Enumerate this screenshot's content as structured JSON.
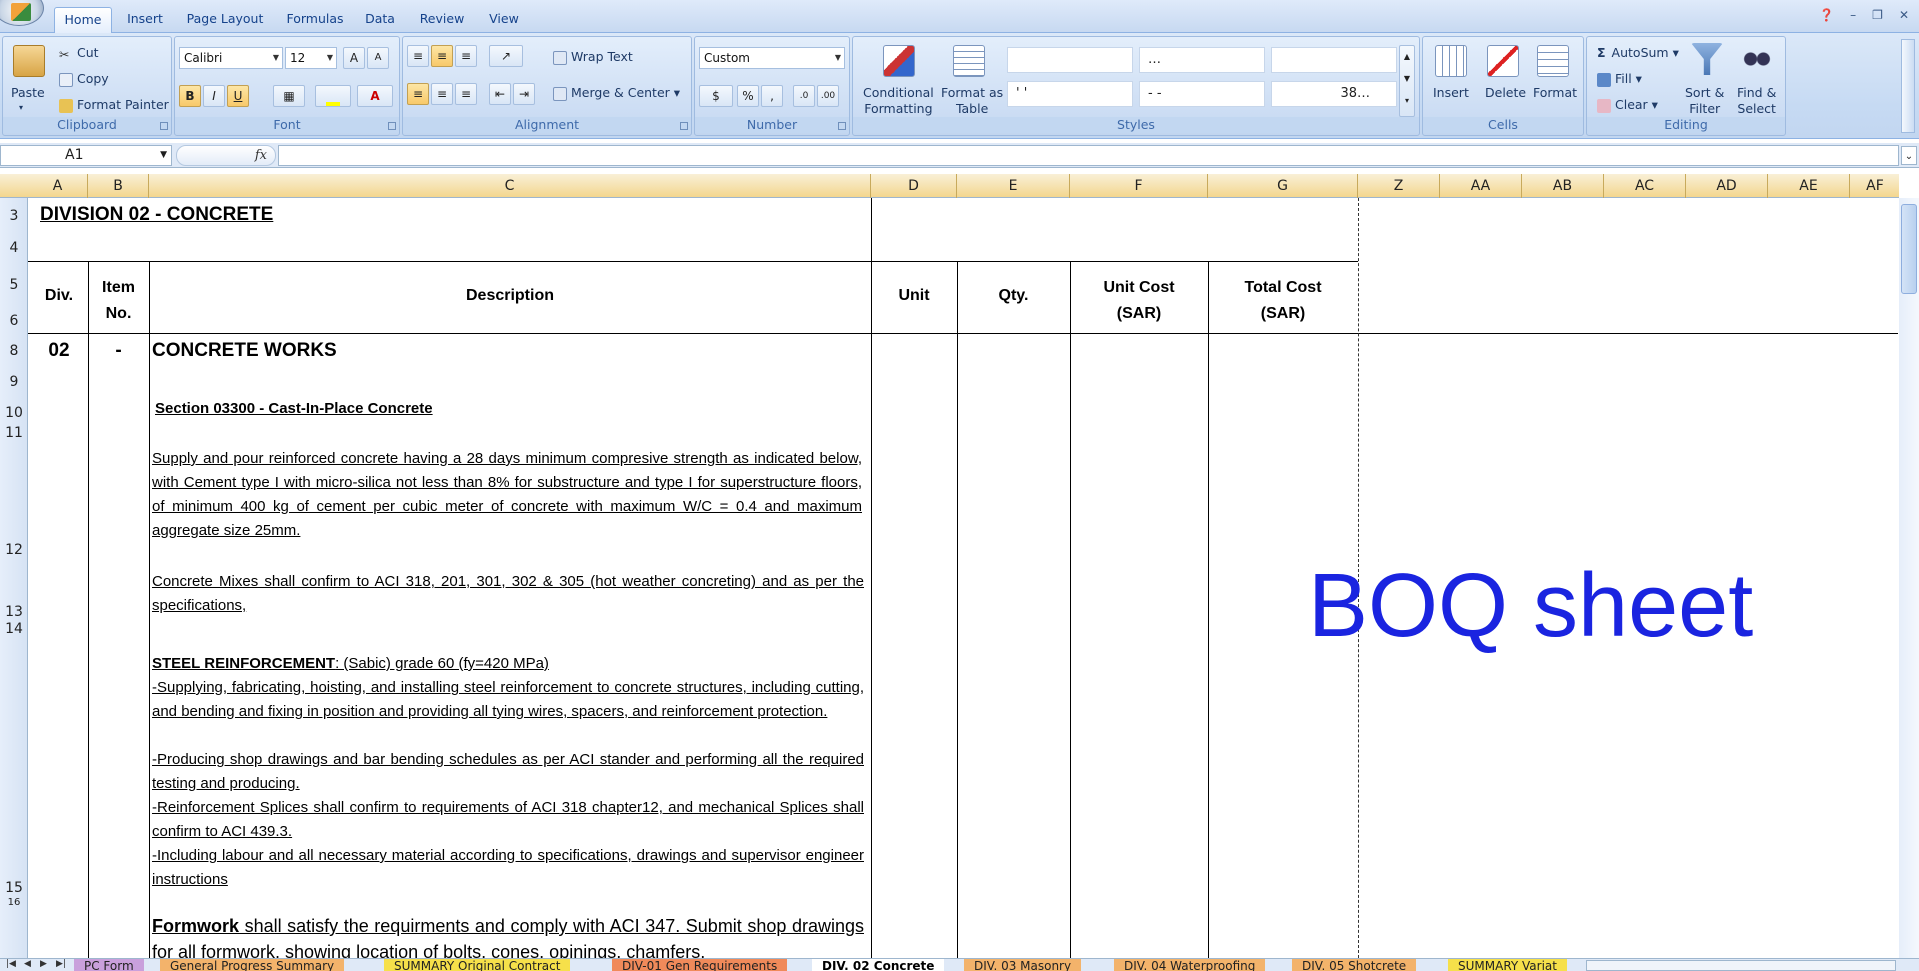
{
  "ribbon_tabs": [
    "Home",
    "Insert",
    "Page Layout",
    "Formulas",
    "Data",
    "Review",
    "View"
  ],
  "active_tab": "Home",
  "clipboard": {
    "paste": "Paste",
    "cut": "Cut",
    "copy": "Copy",
    "format_painter": "Format Painter",
    "label": "Clipboard"
  },
  "font": {
    "name": "Calibri",
    "size": "12",
    "bold": "B",
    "italic": "I",
    "underline": "U",
    "label": "Font"
  },
  "alignment": {
    "wrap": "Wrap Text",
    "merge": "Merge & Center",
    "label": "Alignment"
  },
  "number": {
    "format": "Custom",
    "percent": "%",
    "comma": ",",
    "label": "Number"
  },
  "styles": {
    "conditional": "Conditional\nFormatting",
    "format_table": "Format as\nTable",
    "cells": [
      "",
      "…",
      "",
      "'  '",
      "-   -",
      "38…"
    ],
    "label": "Styles"
  },
  "cells_group": {
    "insert": "Insert",
    "delete": "Delete",
    "format": "Format",
    "label": "Cells"
  },
  "editing": {
    "autosum": "AutoSum",
    "fill": "Fill",
    "clear": "Clear",
    "sort": "Sort &\nFilter",
    "find": "Find &\nSelect",
    "label": "Editing"
  },
  "namebox": "A1",
  "fx": "fx",
  "columns": [
    "A",
    "B",
    "C",
    "D",
    "E",
    "F",
    "G",
    "Z",
    "AA",
    "AB",
    "AC",
    "AD",
    "AE",
    "AF"
  ],
  "rows": [
    "3",
    "4",
    "5",
    "6",
    "8",
    "9",
    "10",
    "11",
    "12",
    "13",
    "14",
    "15",
    "16"
  ],
  "sheet": {
    "division_title": "DIVISION 02 -  CONCRETE",
    "hdr_div": "Div.",
    "hdr_item": "Item\nNo.",
    "hdr_desc": "Description",
    "hdr_unit": "Unit",
    "hdr_qty": "Qty.",
    "hdr_unitcost": "Unit Cost\n(SAR)",
    "hdr_totalcost": "Total Cost\n(SAR)",
    "div_no": "02",
    "item_no": "-",
    "works_title": "CONCRETE WORKS",
    "section": "Section 03300 - Cast-In-Place Concrete",
    "p1": "Supply and pour reinforced concrete having a 28 days minimum compresive strength as indicated below, with Cement type I with micro-silica not less than 8% for substructure and type I for superstructure floors, of minimum 400 kg of cement per cubic meter of concrete with maximum W/C = 0.4 and maximum aggregate size 25mm.",
    "p2": "Concrete Mixes shall confirm to ACI 318, 201, 301, 302 & 305 (hot weather concreting) and as per the specifications,",
    "steel_head": "STEEL REINFORCEMENT",
    "steel_rest": ": (Sabic) grade 60 (fy=420 MPa)",
    "steel_1": "-Supplying, fabricating, hoisting, and installing steel reinforcement to concrete structures, including cutting, and bending and fixing in position and providing all tying wires, spacers, and reinforcement protection.",
    "steel_2": "-Producing shop drawings and bar bending schedules as per ACI stander and performing all the required testing and producing.",
    "steel_3": "-Reinforcement Splices shall confirm to requirements of ACI 318 chapter12, and mechanical Splices shall confirm to ACI 439.3.",
    "steel_4": "-Including labour and all necessary material according to specifications, drawings and supervisor engineer instructions",
    "formwork_head": "Formwork",
    "formwork_rest": " shall satisfy the requirments and comply with ACI 347. Submit shop drawings for all formwork, showing location of bolts, cones, opinings, chamfers,",
    "watermark": "BOQ sheet"
  },
  "sheet_tabs": [
    "PC Form",
    "General Progress Summary",
    "SUMMARY Original Contract",
    "DIV-01 Gen Requirements",
    "DIV. 02 Concrete",
    "DIV. 03 Masonry",
    "DIV. 04 Waterproofing",
    "DIV. 05 Shotcrete",
    "SUMMARY Variat"
  ],
  "active_sheet": "DIV. 02 Concrete"
}
